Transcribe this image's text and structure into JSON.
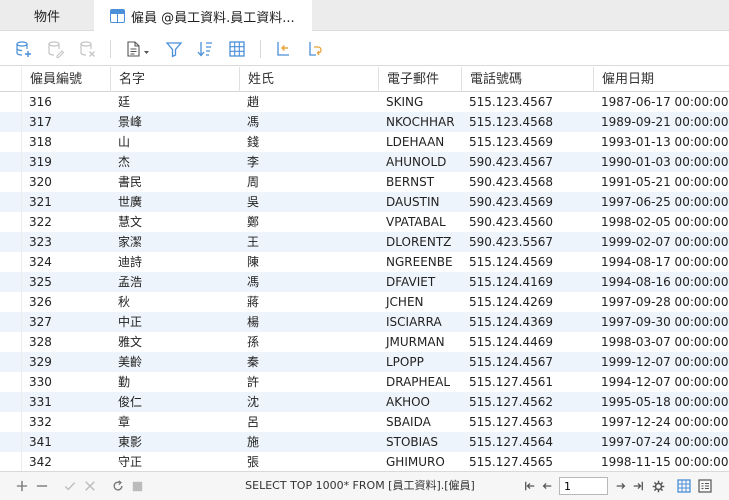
{
  "tabs": [
    {
      "label": "物件"
    },
    {
      "label": "僱員 @員工資料.員工資料..."
    }
  ],
  "grid": {
    "columns": [
      "僱員編號",
      "名字",
      "姓氏",
      "電子郵件",
      "電話號碼",
      "僱用日期"
    ],
    "rows": [
      [
        "316",
        "廷",
        "趙",
        "SKING",
        "515.123.4567",
        "1987-06-17 00:00:00"
      ],
      [
        "317",
        "景峰",
        "馮",
        "NKOCHHAR",
        "515.123.4568",
        "1989-09-21 00:00:00"
      ],
      [
        "318",
        "山",
        "錢",
        "LDEHAAN",
        "515.123.4569",
        "1993-01-13 00:00:00"
      ],
      [
        "319",
        "杰",
        "李",
        "AHUNOLD",
        "590.423.4567",
        "1990-01-03 00:00:00"
      ],
      [
        "320",
        "書民",
        "周",
        "BERNST",
        "590.423.4568",
        "1991-05-21 00:00:00"
      ],
      [
        "321",
        "世廣",
        "吳",
        "DAUSTIN",
        "590.423.4569",
        "1997-06-25 00:00:00"
      ],
      [
        "322",
        "慧文",
        "鄭",
        "VPATABAL",
        "590.423.4560",
        "1998-02-05 00:00:00"
      ],
      [
        "323",
        "家潔",
        "王",
        "DLORENTZ",
        "590.423.5567",
        "1999-02-07 00:00:00"
      ],
      [
        "324",
        "迪詩",
        "陳",
        "NGREENBE",
        "515.124.4569",
        "1994-08-17 00:00:00"
      ],
      [
        "325",
        "孟浩",
        "馮",
        "DFAVIET",
        "515.124.4169",
        "1994-08-16 00:00:00"
      ],
      [
        "326",
        "秋",
        "蔣",
        "JCHEN",
        "515.124.4269",
        "1997-09-28 00:00:00"
      ],
      [
        "327",
        "中正",
        "楊",
        "ISCIARRA",
        "515.124.4369",
        "1997-09-30 00:00:00"
      ],
      [
        "328",
        "雅文",
        "孫",
        "JMURMAN",
        "515.124.4469",
        "1998-03-07 00:00:00"
      ],
      [
        "329",
        "美齡",
        "秦",
        "LPOPP",
        "515.124.4567",
        "1999-12-07 00:00:00"
      ],
      [
        "330",
        "勤",
        "許",
        "DRAPHEAL",
        "515.127.4561",
        "1994-12-07 00:00:00"
      ],
      [
        "331",
        "俊仁",
        "沈",
        "AKHOO",
        "515.127.4562",
        "1995-05-18 00:00:00"
      ],
      [
        "332",
        "章",
        "呂",
        "SBAIDA",
        "515.127.4563",
        "1997-12-24 00:00:00"
      ],
      [
        "341",
        "東影",
        "施",
        "STOBIAS",
        "515.127.4564",
        "1997-07-24 00:00:00"
      ],
      [
        "342",
        "守正",
        "張",
        "GHIMURO",
        "515.127.4565",
        "1998-11-15 00:00:00"
      ]
    ]
  },
  "statusbar": {
    "sql": "SELECT TOP 1000* FROM [員工資料].[僱員]",
    "page": "1"
  },
  "colors": {
    "accent": "#4a8fd8",
    "alt_row": "#eef4fb"
  },
  "icons": [
    "db-add-icon",
    "db-edit-icon",
    "db-delete-icon",
    "document-icon",
    "filter-icon",
    "sort-icon",
    "grid-icon",
    "undo-icon",
    "redo-icon",
    "add-icon",
    "remove-icon",
    "check-icon",
    "cancel-icon",
    "refresh-icon",
    "stop-icon",
    "first-page-icon",
    "prev-page-icon",
    "next-page-icon",
    "last-page-icon",
    "settings-icon",
    "grid-view-icon",
    "form-view-icon"
  ]
}
